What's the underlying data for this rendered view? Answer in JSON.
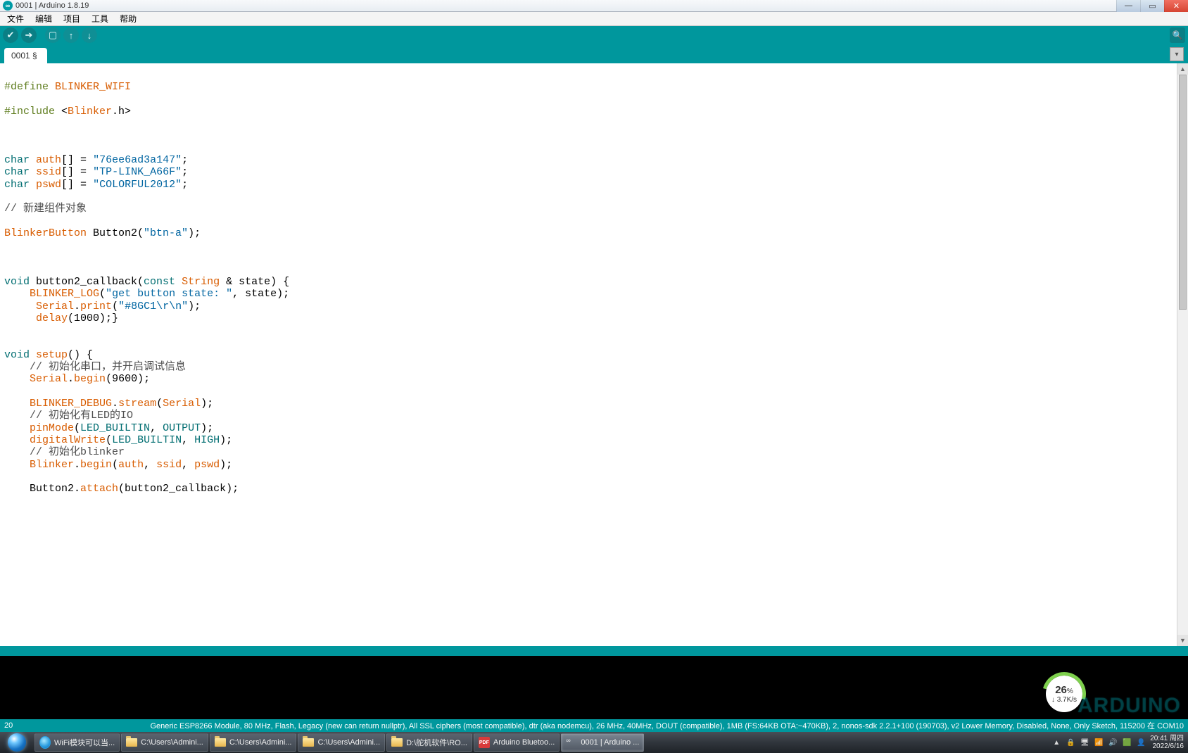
{
  "window": {
    "title": "0001 | Arduino 1.8.19",
    "icon_label": "∞"
  },
  "menu": {
    "items": [
      "文件",
      "编辑",
      "项目",
      "工具",
      "帮助"
    ]
  },
  "toolbar": {
    "verify": "✔",
    "upload": "➔",
    "new": "▢",
    "open": "↑",
    "save": "↓",
    "serial": "🔍"
  },
  "tabs": {
    "active": "0001 §"
  },
  "status": {
    "line": "20",
    "board": "Generic ESP8266 Module, 80 MHz, Flash, Legacy (new can return nullptr), All SSL ciphers (most compatible), dtr (aka nodemcu), 26 MHz, 40MHz, DOUT (compatible), 1MB (FS:64KB OTA:~470KB), 2, nonos-sdk 2.2.1+100 (190703), v2 Lower Memory, Disabled, None, Only Sketch, 115200 在 COM10"
  },
  "code": {
    "l1a": "#define",
    "l1b": "BLINKER_WIFI",
    "l2a": "#include",
    "l2b": "Blinker",
    "l2c": ".h>",
    "l3a": "char",
    "l3b": "auth",
    "l3c": "[] = ",
    "l3d": "\"76ee6ad3a147\"",
    "l3e": ";",
    "l4a": "char",
    "l4b": "ssid",
    "l4c": "[] = ",
    "l4d": "\"TP-LINK_A66F\"",
    "l4e": ";",
    "l5a": "char",
    "l5b": "pswd",
    "l5c": "[] = ",
    "l5d": "\"COLORFUL2012\"",
    "l5e": ";",
    "l6": "// 新建组件对象",
    "l7a": "BlinkerButton",
    "l7b": " Button2(",
    "l7c": "\"btn-a\"",
    "l7d": ");",
    "l8a": "void",
    "l8b": " button2_callback(",
    "l8c": "const",
    "l8d": "String",
    "l8e": " & state) {",
    "l9a": "BLINKER_LOG",
    "l9b": "(",
    "l9c": "\"get button state: \"",
    "l9d": ", state);",
    "l10a": "Serial",
    "l10b": ".",
    "l10c": "print",
    "l10d": "(",
    "l10e": "\"#8GC1\\r\\n\"",
    "l10f": ");",
    "l11a": "delay",
    "l11b": "(1000);}",
    "l12a": "void",
    "l12b": "setup",
    "l12c": "() {",
    "l13": "// 初始化串口，并开启调试信息",
    "l14a": "Serial",
    "l14b": ".",
    "l14c": "begin",
    "l14d": "(9600);",
    "l15a": "BLINKER_DEBUG",
    "l15b": ".",
    "l15c": "stream",
    "l15d": "(",
    "l15e": "Serial",
    "l15f": ");",
    "l16": "// 初始化有LED的IO",
    "l17a": "pinMode",
    "l17b": "(",
    "l17c": "LED_BUILTIN",
    "l17d": ", ",
    "l17e": "OUTPUT",
    "l17f": ");",
    "l18a": "digitalWrite",
    "l18b": "(",
    "l18c": "LED_BUILTIN",
    "l18d": ", ",
    "l18e": "HIGH",
    "l18f": ");",
    "l19": "// 初始化blinker",
    "l20a": "Blinker",
    "l20b": ".",
    "l20c": "begin",
    "l20d": "(",
    "l20e": "auth",
    "l20f": ", ",
    "l20g": "ssid",
    "l20h": ", ",
    "l20i": "pswd",
    "l20j": ");",
    "l21a": "Button2.",
    "l21b": "attach",
    "l21c": "(button2_callback);"
  },
  "taskbar": {
    "items": [
      {
        "label": "WiFi模块可以当...",
        "type": "ie"
      },
      {
        "label": "C:\\Users\\Admini...",
        "type": "folder"
      },
      {
        "label": "C:\\Users\\Admini...",
        "type": "folder"
      },
      {
        "label": "C:\\Users\\Admini...",
        "type": "folder"
      },
      {
        "label": "D:\\舵机软件\\RO...",
        "type": "folder"
      },
      {
        "label": "Arduino Bluetoo...",
        "type": "pdf"
      },
      {
        "label": "0001 | Arduino ...",
        "type": "arduino",
        "active": true
      }
    ],
    "tray_icons": [
      "▲",
      "🔒",
      "🖥",
      "📶",
      "🔊",
      "🟩",
      "👤"
    ],
    "clock_time": "20:41 周四",
    "clock_date": "2022/6/16"
  },
  "speed": {
    "pct": "26",
    "unit": "%",
    "rate": "↓ 3.7K/s"
  },
  "watermark": "ARDUINO"
}
